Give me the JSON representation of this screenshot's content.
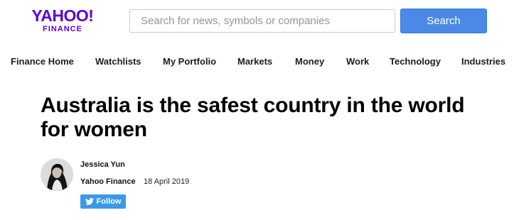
{
  "brand": {
    "logo_main": "YAHOO!",
    "logo_sub": "FINANCE"
  },
  "search": {
    "placeholder": "Search for news, symbols or companies",
    "button_label": "Search"
  },
  "nav": {
    "items": [
      {
        "label": "Finance Home"
      },
      {
        "label": "Watchlists"
      },
      {
        "label": "My Portfolio"
      },
      {
        "label": "Markets"
      },
      {
        "label": "Money"
      },
      {
        "label": "Work"
      },
      {
        "label": "Technology"
      },
      {
        "label": "Industries"
      }
    ]
  },
  "article": {
    "headline": "Australia is the safest country in the world for women",
    "author": "Jessica Yun",
    "provider": "Yahoo Finance",
    "date": "18 April 2019",
    "follow_label": "Follow"
  },
  "icons": {
    "follow": "twitter-bird-icon",
    "avatar": "author-avatar"
  },
  "colors": {
    "brand": "#6001d2",
    "search_button": "#4a8ae6",
    "follow_button": "#3a9ae6"
  }
}
